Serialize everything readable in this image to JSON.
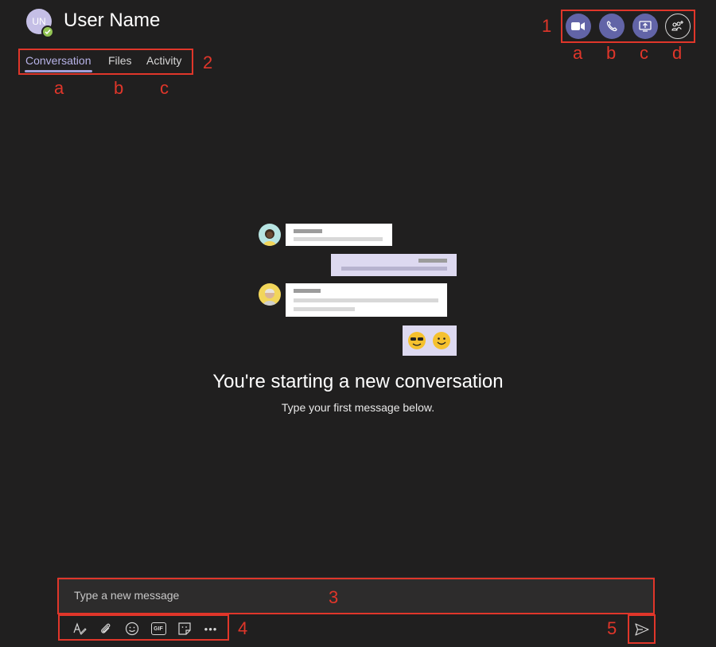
{
  "header": {
    "avatar_initials": "UN",
    "user_name": "User Name",
    "presence_color": "#92c353"
  },
  "tabs": [
    {
      "label": "Conversation",
      "active": true
    },
    {
      "label": "Files",
      "active": false
    },
    {
      "label": "Activity",
      "active": false
    }
  ],
  "call_controls": [
    {
      "icon": "video-call-icon"
    },
    {
      "icon": "audio-call-icon"
    },
    {
      "icon": "share-screen-icon"
    },
    {
      "icon": "add-people-icon"
    }
  ],
  "annotations": {
    "n1": "1",
    "n2": "2",
    "n3": "3",
    "n4": "4",
    "n5": "5",
    "call_a": "a",
    "call_b": "b",
    "call_c": "c",
    "call_d": "d",
    "tab_a": "a",
    "tab_b": "b",
    "tab_c": "c"
  },
  "empty_state": {
    "title": "You're starting a new conversation",
    "subtitle": "Type your first message below."
  },
  "compose": {
    "placeholder": "Type a new message"
  },
  "compose_toolbar": [
    {
      "icon": "format-icon"
    },
    {
      "icon": "attach-icon"
    },
    {
      "icon": "emoji-icon"
    },
    {
      "icon": "gif-icon",
      "label": "GIF"
    },
    {
      "icon": "sticker-icon"
    },
    {
      "icon": "more-options-icon",
      "label": "•••"
    }
  ],
  "send": {
    "icon": "send-icon"
  },
  "colors": {
    "background": "#201f1f",
    "accent": "#6264a7",
    "annotation": "#e0362a"
  }
}
